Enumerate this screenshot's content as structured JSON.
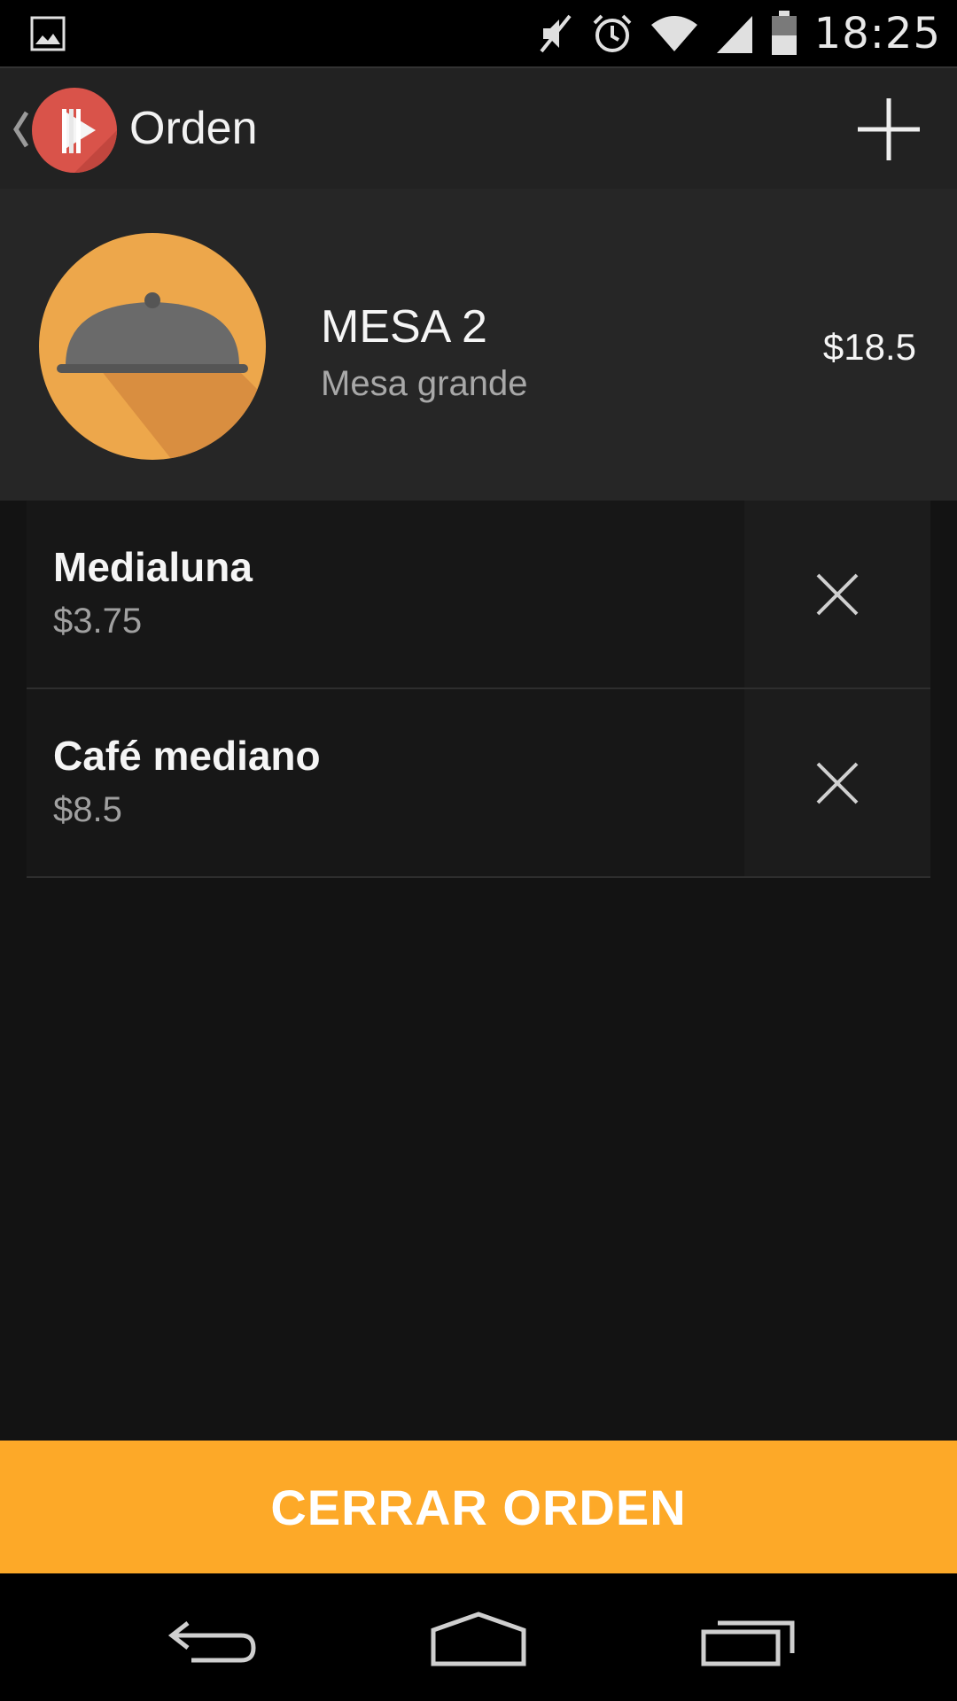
{
  "status_bar": {
    "time": "18:25",
    "icons": [
      "gallery-notification-icon",
      "muted-icon",
      "alarm-icon",
      "wifi-icon",
      "signal-icon",
      "battery-icon"
    ]
  },
  "action_bar": {
    "title": "Orden",
    "logo_icon": "restaurant-play-logo",
    "back_icon": "chevron-left-icon",
    "add_icon": "plus-icon"
  },
  "table": {
    "name": "MESA 2",
    "description": "Mesa grande",
    "total": "$18.5",
    "avatar_icon": "food-cloche-icon"
  },
  "order_items": [
    {
      "name": "Medialuna",
      "price": "$3.75"
    },
    {
      "name": "Café mediano",
      "price": "$8.5"
    }
  ],
  "close_button": {
    "label": "CERRAR ORDEN"
  },
  "colors": {
    "accent": "#fda928",
    "avatar": "#eda74b",
    "logo": "#d9534a"
  },
  "nav_bar": {
    "icons": [
      "back-icon",
      "home-icon",
      "recents-icon"
    ]
  }
}
